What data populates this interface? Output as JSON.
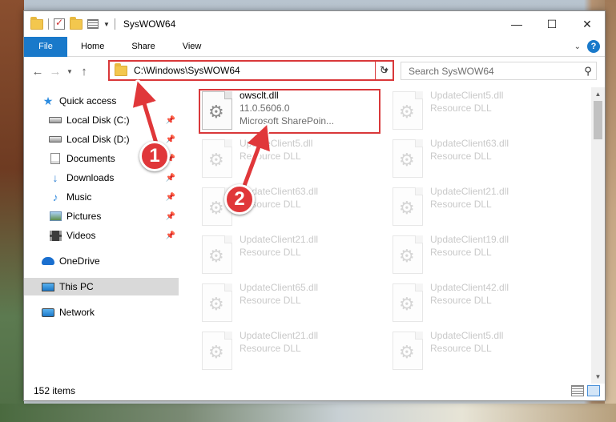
{
  "window": {
    "title": "SysWOW64",
    "controls": {
      "minimize": "—",
      "maximize": "☐",
      "close": "✕"
    }
  },
  "ribbon": {
    "tabs": [
      "File",
      "Home",
      "Share",
      "View"
    ],
    "help": "?"
  },
  "address_bar": {
    "path": "C:\\Windows\\SysWOW64"
  },
  "search": {
    "placeholder": "Search SysWOW64"
  },
  "navigation": {
    "items": [
      {
        "label": "Quick access",
        "icon": "star-icon",
        "pinned": false
      },
      {
        "label": "Local Disk (C:)",
        "icon": "disk-icon",
        "pinned": true
      },
      {
        "label": "Local Disk (D:)",
        "icon": "disk-icon",
        "pinned": true
      },
      {
        "label": "Documents",
        "icon": "document-icon",
        "pinned": true
      },
      {
        "label": "Downloads",
        "icon": "download-icon",
        "pinned": true
      },
      {
        "label": "Music",
        "icon": "music-icon",
        "pinned": true
      },
      {
        "label": "Pictures",
        "icon": "pictures-icon",
        "pinned": true
      },
      {
        "label": "Videos",
        "icon": "videos-icon",
        "pinned": true
      },
      {
        "label": "OneDrive",
        "icon": "onedrive-icon",
        "pinned": false
      },
      {
        "label": "This PC",
        "icon": "this-pc-icon",
        "pinned": false,
        "selected": true
      },
      {
        "label": "Network",
        "icon": "network-icon",
        "pinned": false
      }
    ]
  },
  "files": [
    {
      "name": "owsclt.dll",
      "line2": "11.0.5606.0",
      "line3": "Microsoft SharePoin...",
      "highlighted": true
    },
    {
      "name": "UpdateClient5.dll",
      "line2": "Resource DLL"
    },
    {
      "name": "UpdateClient5.dll",
      "line2": "Resource DLL"
    },
    {
      "name": "UpdateClient63.dll",
      "line2": "Resource DLL"
    },
    {
      "name": "UpdateClient63.dll",
      "line2": "Resource DLL"
    },
    {
      "name": "UpdateClient21.dll",
      "line2": "Resource DLL"
    },
    {
      "name": "UpdateClient21.dll",
      "line2": "Resource DLL"
    },
    {
      "name": "UpdateClient19.dll",
      "line2": "Resource DLL"
    },
    {
      "name": "UpdateClient65.dll",
      "line2": "Resource DLL"
    },
    {
      "name": "UpdateClient42.dll",
      "line2": "Resource DLL"
    },
    {
      "name": "UpdateClient21.dll",
      "line2": "Resource DLL"
    },
    {
      "name": "UpdateClient5.dll",
      "line2": "Resource DLL"
    }
  ],
  "status": {
    "item_count": "152 items"
  },
  "annotations": {
    "badge1": "1",
    "badge2": "2",
    "color": "#e0373a"
  }
}
